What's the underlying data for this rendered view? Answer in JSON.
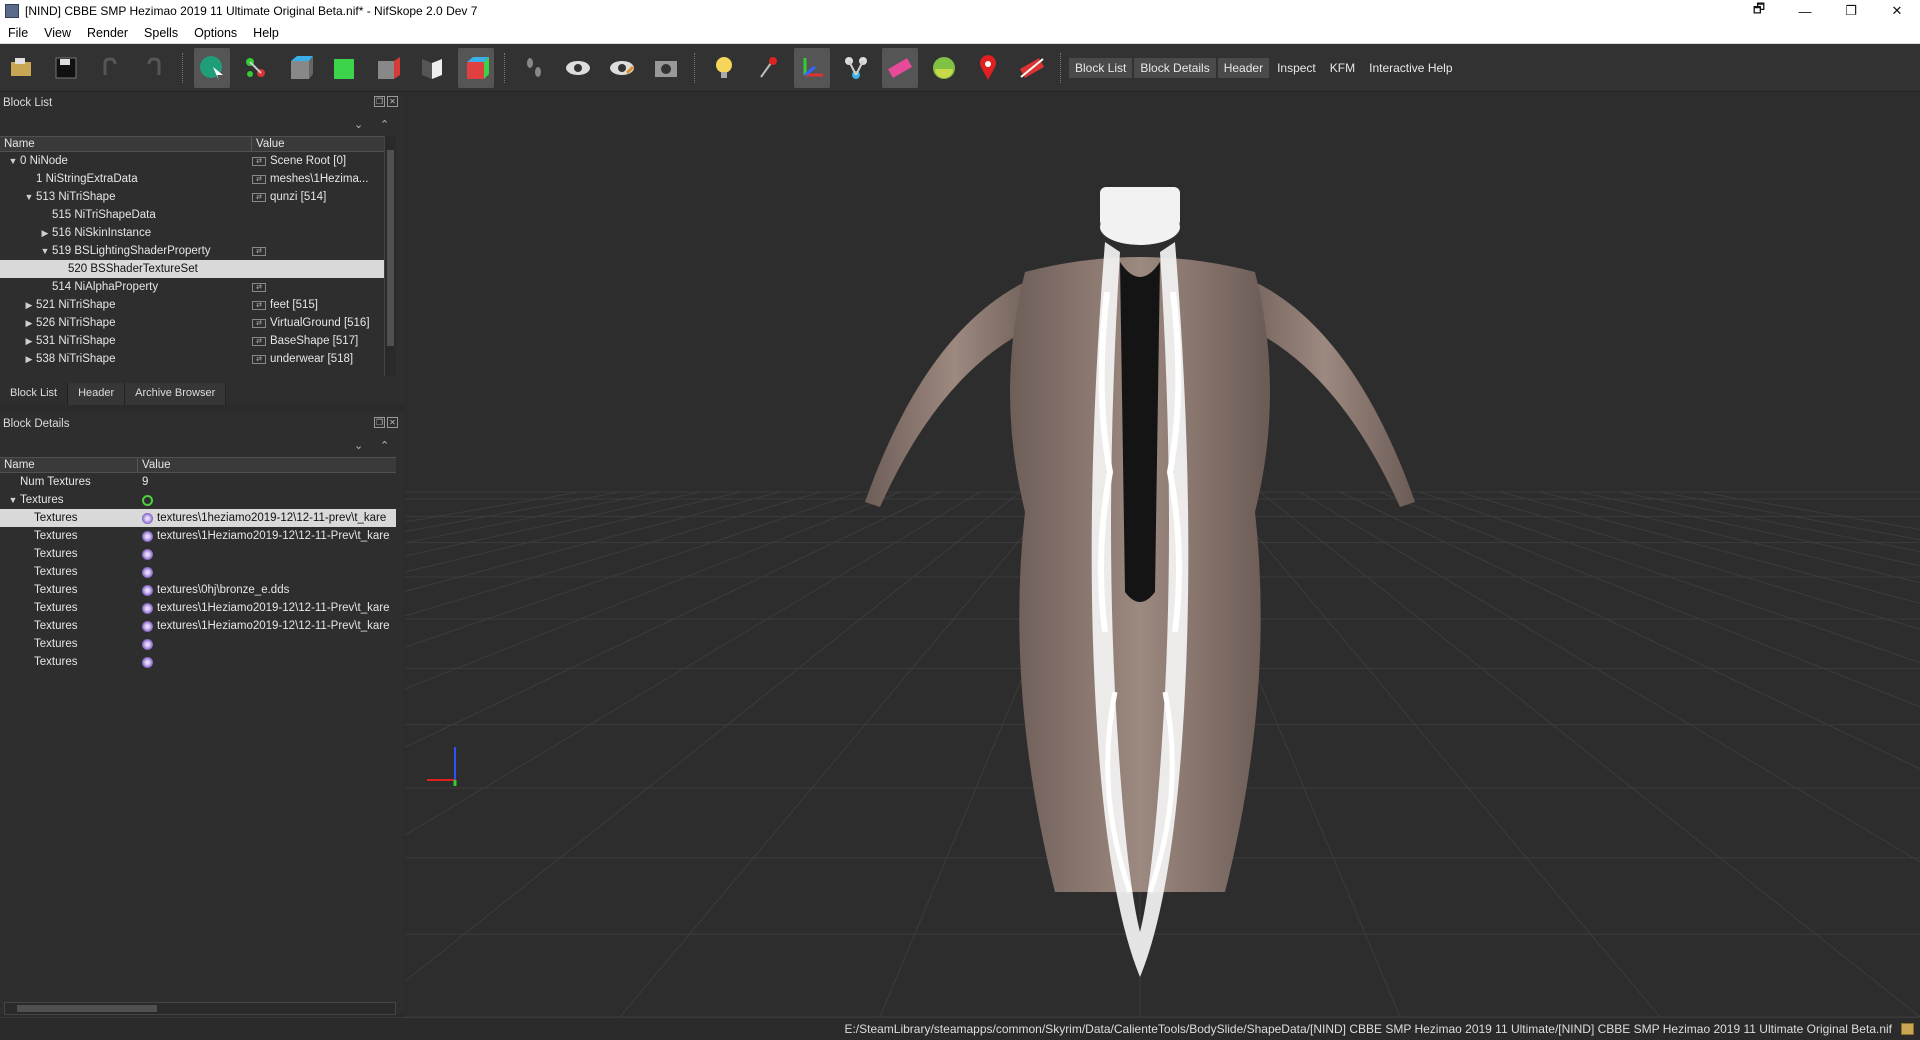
{
  "window": {
    "title": "[NIND] CBBE SMP Hezimao 2019 11 Ultimate Original Beta.nif* - NifSkope 2.0 Dev 7",
    "controls": [
      "🗗",
      "—",
      "❐",
      "✕"
    ]
  },
  "menu": [
    "File",
    "View",
    "Render",
    "Spells",
    "Options",
    "Help"
  ],
  "toolbar_text": {
    "block_list": "Block List",
    "block_details": "Block Details",
    "header": "Header",
    "inspect": "Inspect",
    "kfm": "KFM",
    "interactive_help": "Interactive Help"
  },
  "block_list": {
    "title": "Block List",
    "col_name": "Name",
    "col_value": "Value",
    "rows": [
      {
        "name": "0 NiNode",
        "value": "Scene Root [0]",
        "indent": 0,
        "arrow": "down",
        "link": true,
        "selected": false
      },
      {
        "name": "1 NiStringExtraData",
        "value": "meshes\\1Hezima...",
        "indent": 1,
        "arrow": "",
        "link": true,
        "selected": false
      },
      {
        "name": "513 NiTriShape",
        "value": "qunzi [514]",
        "indent": 1,
        "arrow": "down",
        "link": true,
        "selected": false
      },
      {
        "name": "515 NiTriShapeData",
        "value": "",
        "indent": 2,
        "arrow": "",
        "link": false,
        "selected": false
      },
      {
        "name": "516 NiSkinInstance",
        "value": "",
        "indent": 2,
        "arrow": "right",
        "link": false,
        "selected": false
      },
      {
        "name": "519 BSLightingShaderProperty",
        "value": "",
        "indent": 2,
        "arrow": "down",
        "link": true,
        "selected": false
      },
      {
        "name": "520 BSShaderTextureSet",
        "value": "",
        "indent": 3,
        "arrow": "",
        "link": false,
        "selected": true
      },
      {
        "name": "514 NiAlphaProperty",
        "value": "",
        "indent": 2,
        "arrow": "",
        "link": true,
        "selected": false
      },
      {
        "name": "521 NiTriShape",
        "value": "feet [515]",
        "indent": 1,
        "arrow": "right",
        "link": true,
        "selected": false
      },
      {
        "name": "526 NiTriShape",
        "value": "VirtualGround [516]",
        "indent": 1,
        "arrow": "right",
        "link": true,
        "selected": false
      },
      {
        "name": "531 NiTriShape",
        "value": "BaseShape [517]",
        "indent": 1,
        "arrow": "right",
        "link": true,
        "selected": false
      },
      {
        "name": "538 NiTriShape",
        "value": "underwear [518]",
        "indent": 1,
        "arrow": "right",
        "link": true,
        "selected": false
      }
    ],
    "tabs": [
      "Block List",
      "Header",
      "Archive Browser"
    ]
  },
  "block_details": {
    "title": "Block Details",
    "col_name": "Name",
    "col_value": "Value",
    "rows": [
      {
        "name": "Num Textures",
        "value": "9",
        "indent": 1,
        "arrow": "",
        "icon": "",
        "selected": false
      },
      {
        "name": "Textures",
        "value": "",
        "indent": 0,
        "arrow": "down",
        "icon": "green",
        "selected": false
      },
      {
        "name": "Textures",
        "value": "textures\\1heziamo2019-12\\12-11-prev\\t_kare",
        "indent": 2,
        "arrow": "",
        "icon": "tex",
        "selected": true
      },
      {
        "name": "Textures",
        "value": "textures\\1Heziamo2019-12\\12-11-Prev\\t_kare",
        "indent": 2,
        "arrow": "",
        "icon": "tex",
        "selected": false
      },
      {
        "name": "Textures",
        "value": "",
        "indent": 2,
        "arrow": "",
        "icon": "tex",
        "selected": false
      },
      {
        "name": "Textures",
        "value": "",
        "indent": 2,
        "arrow": "",
        "icon": "tex",
        "selected": false
      },
      {
        "name": "Textures",
        "value": "textures\\0hj\\bronze_e.dds",
        "indent": 2,
        "arrow": "",
        "icon": "tex",
        "selected": false
      },
      {
        "name": "Textures",
        "value": "textures\\1Heziamo2019-12\\12-11-Prev\\t_kare",
        "indent": 2,
        "arrow": "",
        "icon": "tex",
        "selected": false
      },
      {
        "name": "Textures",
        "value": "textures\\1Heziamo2019-12\\12-11-Prev\\t_kare",
        "indent": 2,
        "arrow": "",
        "icon": "tex",
        "selected": false
      },
      {
        "name": "Textures",
        "value": "",
        "indent": 2,
        "arrow": "",
        "icon": "tex",
        "selected": false
      },
      {
        "name": "Textures",
        "value": "",
        "indent": 2,
        "arrow": "",
        "icon": "tex",
        "selected": false
      }
    ]
  },
  "statusbar": {
    "path": "E:/SteamLibrary/steamapps/common/Skyrim/Data/CalienteTools/BodySlide/ShapeData/[NIND] CBBE SMP Hezimao 2019 11 Ultimate/[NIND] CBBE SMP Hezimao 2019 11 Ultimate Original Beta.nif"
  },
  "icons": [
    "load-icon",
    "save-icon",
    "undo-icon",
    "redo-icon",
    "select-icon",
    "connect-icon",
    "view-front-icon",
    "view-top-icon",
    "view-side-icon",
    "view-flip-icon",
    "perspective-icon",
    "walk-icon",
    "show-hidden-icon",
    "show-hidden-alt-icon",
    "screenshot-icon",
    "light-icon",
    "pin-icon",
    "axes-icon",
    "nodes-icon",
    "blend-icon",
    "lighting-icon",
    "marker-icon",
    "no-collision-icon"
  ]
}
